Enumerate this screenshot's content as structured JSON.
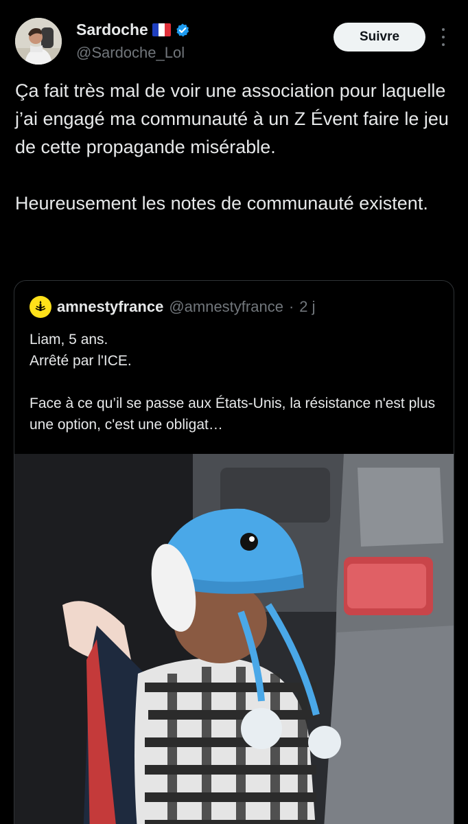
{
  "author": {
    "name": "Sardoche",
    "handle": "@Sardoche_Lol",
    "flag": "french-flag",
    "verified": true,
    "follow_label": "Suivre"
  },
  "tweet": {
    "paragraphs": [
      "Ça fait très mal de voir une association pour laquelle j’ai engagé ma communauté à un Z Évent faire le jeu de cette propagande misérable.",
      "Heureusement les notes de communauté existent."
    ]
  },
  "quoted": {
    "name": "amnestyfrance",
    "handle": "@amnestyfrance",
    "sep": "·",
    "time": "2 j",
    "lines": [
      "Liam, 5 ans.",
      "Arrêté par l'ICE.",
      "",
      "Face à ce qu’il se passe aux États-Unis, la résistance n'est plus une option, c'est une obligat…"
    ]
  },
  "colors": {
    "background": "#000000",
    "text": "#e7e9ea",
    "muted": "#71767b",
    "verified_blue": "#1d9bf0",
    "amnesty_yellow": "#ffe11a"
  },
  "icons": [
    "verified-badge-icon",
    "more-options-icon",
    "amnesty-candle-logo"
  ]
}
